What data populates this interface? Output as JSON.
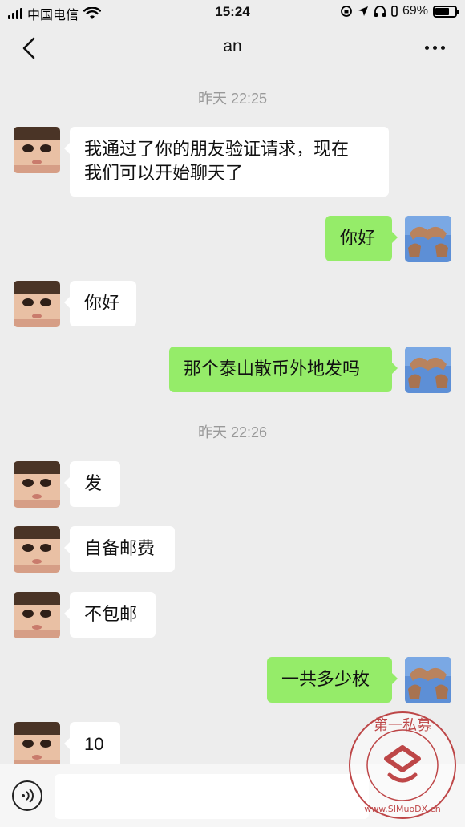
{
  "status_bar": {
    "carrier": "中国电信",
    "time": "15:24",
    "battery": "69%",
    "battery_level": 0.69
  },
  "nav": {
    "title": "an",
    "back_icon": "chevron-left-icon",
    "more_icon": "more-dots-icon"
  },
  "timestamps": [
    "昨天 22:25",
    "昨天 22:26"
  ],
  "messages": [
    {
      "side": "in",
      "text": "我通过了你的朋友验证请求，现在\n我们可以开始聊天了"
    },
    {
      "side": "out",
      "text": "你好"
    },
    {
      "side": "in",
      "text": "你好"
    },
    {
      "side": "out",
      "text": "那个泰山散币外地发吗"
    },
    {
      "side": "in",
      "text": "发"
    },
    {
      "side": "in",
      "text": "自备邮费"
    },
    {
      "side": "in",
      "text": "不包邮"
    },
    {
      "side": "out",
      "text": "一共多少枚"
    },
    {
      "side": "in",
      "text": "10"
    }
  ],
  "input_bar": {
    "value": "",
    "voice_icon": "voice-icon"
  },
  "watermark": {
    "text": "第一私募",
    "url": "www.SIMuoDX.cn"
  },
  "colors": {
    "background": "#ededed",
    "incoming_bubble": "#ffffff",
    "outgoing_bubble": "#95ec69",
    "timestamp": "#999999",
    "watermark": "#b5292b"
  }
}
